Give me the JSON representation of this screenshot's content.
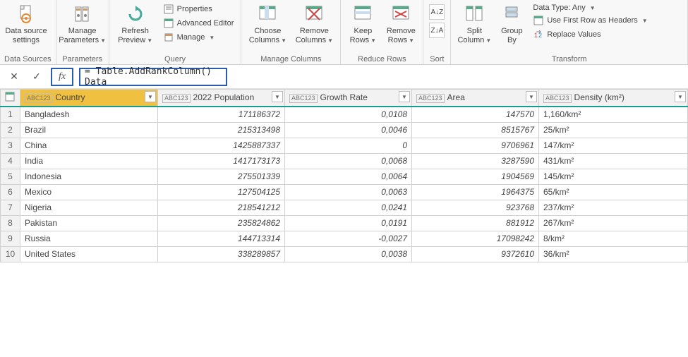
{
  "ribbon": {
    "groups": {
      "data_sources": {
        "label": "Data Sources",
        "btn": "Data source\nsettings"
      },
      "parameters": {
        "label": "Parameters",
        "btn": "Manage\nParameters"
      },
      "query": {
        "label": "Query",
        "refresh": "Refresh\nPreview",
        "properties": "Properties",
        "advanced": "Advanced Editor",
        "manage": "Manage"
      },
      "manage_columns": {
        "label": "Manage Columns",
        "choose": "Choose\nColumns",
        "remove": "Remove\nColumns"
      },
      "reduce_rows": {
        "label": "Reduce Rows",
        "keep": "Keep\nRows",
        "remove": "Remove\nRows"
      },
      "sort": {
        "label": "Sort",
        "asc": "A↓Z",
        "desc": "Z↓A"
      },
      "transform": {
        "label": "Transform",
        "split": "Split\nColumn",
        "group": "Group\nBy",
        "datatype": "Data Type: Any",
        "firstrow": "Use First Row as Headers",
        "replace": "Replace Values"
      }
    }
  },
  "formula": {
    "text": "= Table.AddRankColumn() Data"
  },
  "columns": [
    {
      "name": "Country",
      "type": "ABC123",
      "selected": true
    },
    {
      "name": "2022 Population",
      "type": "ABC123",
      "selected": false
    },
    {
      "name": "Growth Rate",
      "type": "ABC123",
      "selected": false
    },
    {
      "name": "Area",
      "type": "ABC123",
      "selected": false
    },
    {
      "name": "Density (km²)",
      "type": "ABC123",
      "selected": false
    }
  ],
  "rows": [
    {
      "n": "1",
      "country": "Bangladesh",
      "pop": "171186372",
      "growth": "0,0108",
      "area": "147570",
      "density": "1,160/km²"
    },
    {
      "n": "2",
      "country": "Brazil",
      "pop": "215313498",
      "growth": "0,0046",
      "area": "8515767",
      "density": "25/km²"
    },
    {
      "n": "3",
      "country": "China",
      "pop": "1425887337",
      "growth": "0",
      "area": "9706961",
      "density": "147/km²"
    },
    {
      "n": "4",
      "country": "India",
      "pop": "1417173173",
      "growth": "0,0068",
      "area": "3287590",
      "density": "431/km²"
    },
    {
      "n": "5",
      "country": "Indonesia",
      "pop": "275501339",
      "growth": "0,0064",
      "area": "1904569",
      "density": "145/km²"
    },
    {
      "n": "6",
      "country": "Mexico",
      "pop": "127504125",
      "growth": "0,0063",
      "area": "1964375",
      "density": "65/km²"
    },
    {
      "n": "7",
      "country": "Nigeria",
      "pop": "218541212",
      "growth": "0,0241",
      "area": "923768",
      "density": "237/km²"
    },
    {
      "n": "8",
      "country": "Pakistan",
      "pop": "235824862",
      "growth": "0,0191",
      "area": "881912",
      "density": "267/km²"
    },
    {
      "n": "9",
      "country": "Russia",
      "pop": "144713314",
      "growth": "-0,0027",
      "area": "17098242",
      "density": "8/km²"
    },
    {
      "n": "10",
      "country": "United States",
      "pop": "338289857",
      "growth": "0,0038",
      "area": "9372610",
      "density": "36/km²"
    }
  ]
}
